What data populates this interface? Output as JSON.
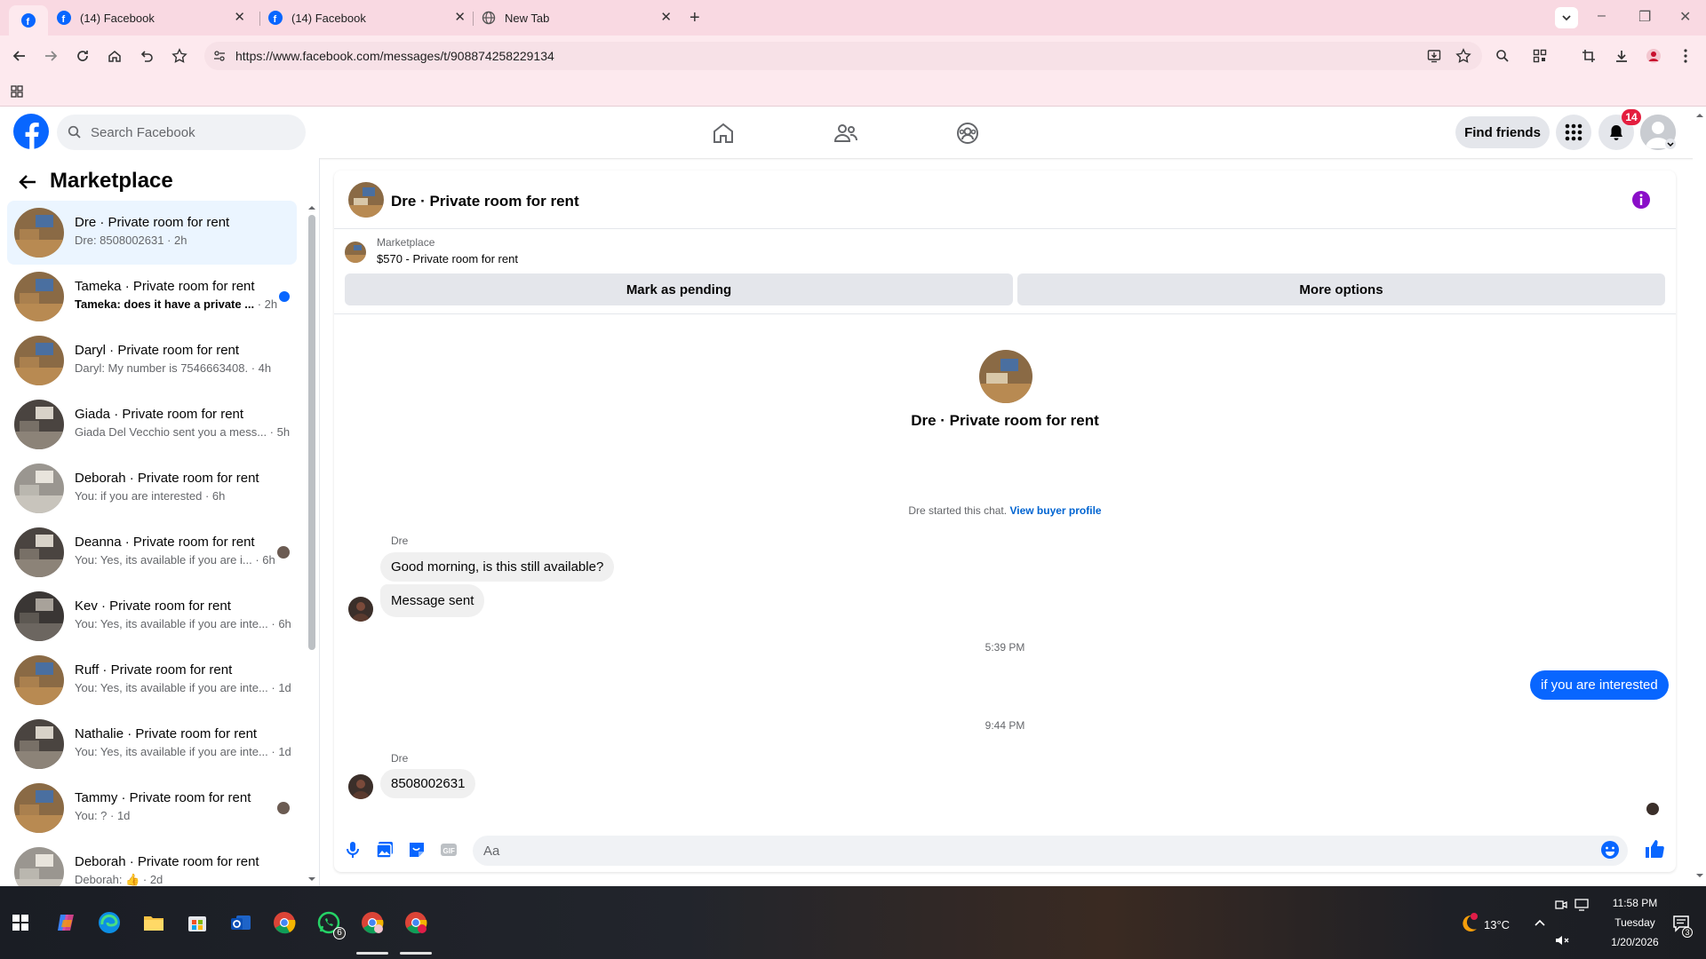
{
  "browser": {
    "tabs": [
      {
        "title": "(14) Facebook"
      },
      {
        "title": "(14) Facebook"
      },
      {
        "title": "New Tab"
      }
    ],
    "url": "https://www.facebook.com/messages/t/908874258229134"
  },
  "header": {
    "search_placeholder": "Search Facebook",
    "find_friends": "Find friends",
    "notification_count": "14"
  },
  "sidebar": {
    "title": "Marketplace",
    "conversations": [
      {
        "name": "Dre · Private room for rent",
        "preview": "Dre: 8508002631 · 2h",
        "active": true,
        "unread": false
      },
      {
        "name": "Tameka · Private room for rent",
        "preview": "Tameka: does it have a private ...",
        "time": " · 2h",
        "unread": true
      },
      {
        "name": "Daryl · Private room for rent",
        "preview": "Daryl: My number is 7546663408. · 4h"
      },
      {
        "name": "Giada · Private room for rent",
        "preview": "Giada Del Vecchio sent you a mess... · 5h"
      },
      {
        "name": "Deborah · Private room for rent",
        "preview": "You: if you are interested · 6h"
      },
      {
        "name": "Deanna · Private room for rent",
        "preview": "You: Yes, its available if you are i... · 6h",
        "seen": true
      },
      {
        "name": "Kev · Private room for rent",
        "preview": "You: Yes, its available if you are inte... · 6h"
      },
      {
        "name": "Ruff · Private room for rent",
        "preview": "You: Yes, its available if you are inte... · 1d"
      },
      {
        "name": "Nathalie · Private room for rent",
        "preview": "You: Yes, its available if you are inte... · 1d"
      },
      {
        "name": "Tammy · Private room for rent",
        "preview": "You: ? · 1d",
        "seen": true
      },
      {
        "name": "Deborah · Private room for rent",
        "preview": "Deborah: 👍 · 2d"
      }
    ]
  },
  "chat": {
    "title": "Dre · Private room for rent",
    "listing_source": "Marketplace",
    "listing_title": "$570 - Private room for rent",
    "mark_pending": "Mark as pending",
    "more_options": "More options",
    "center_name": "Dre · Private room for rent",
    "started_text": "Dre started this chat.",
    "view_profile": "View buyer profile",
    "sender_1": "Dre",
    "msg_1": "Good morning, is this still available?",
    "msg_2": "Message sent",
    "time_1": "5:39 PM",
    "msg_out": "if you are interested",
    "time_2": "9:44 PM",
    "sender_2": "Dre",
    "msg_3": "8508002631",
    "composer_placeholder": "Aa"
  },
  "taskbar": {
    "whatsapp_badge": "6",
    "weather": "13°C",
    "time": "11:58 PM",
    "day": "Tuesday",
    "date": "1/20/2026",
    "notif_count": "3"
  },
  "colors": {
    "fb_blue": "#0866ff",
    "tab_bg": "#f9d9e2",
    "active_conv": "#ebf5ff"
  }
}
